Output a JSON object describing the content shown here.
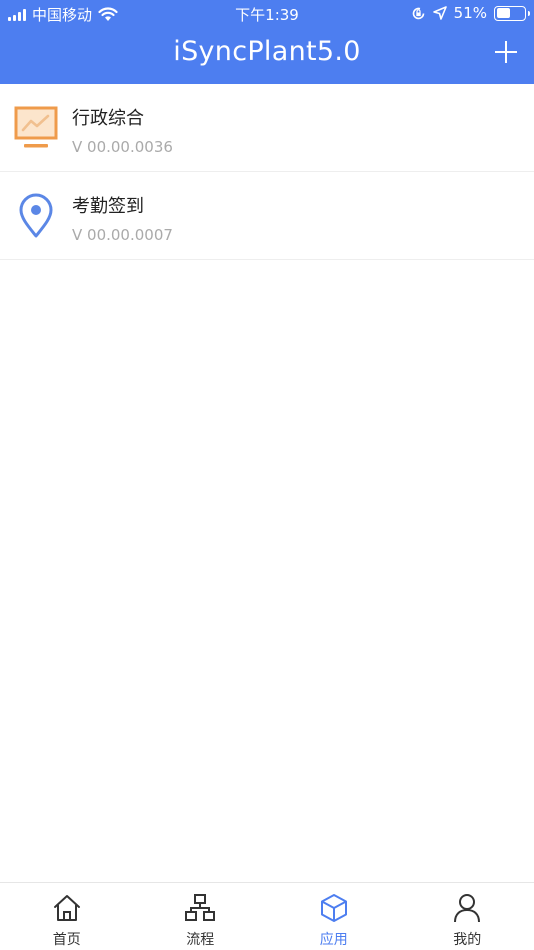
{
  "status_bar": {
    "carrier": "中国移动",
    "time": "下午1:39",
    "battery": "51%",
    "battery_level": 0.51,
    "icons": [
      "signal-icon",
      "wifi-icon",
      "orientation-lock-icon",
      "location-icon",
      "battery-icon"
    ]
  },
  "header": {
    "title": "iSyncPlant5.0",
    "add_icon": "plus-icon"
  },
  "apps": [
    {
      "name": "行政综合",
      "version": "V 00.00.0036",
      "icon": "monitor-chart-icon",
      "color": "#ef9b4b"
    },
    {
      "name": "考勤签到",
      "version": "V 00.00.0007",
      "icon": "location-pin-icon",
      "color": "#5b87e6"
    }
  ],
  "tabs": [
    {
      "label": "首页",
      "icon": "home-icon",
      "active": false
    },
    {
      "label": "流程",
      "icon": "flow-icon",
      "active": false
    },
    {
      "label": "应用",
      "icon": "cube-icon",
      "active": true
    },
    {
      "label": "我的",
      "icon": "user-icon",
      "active": false
    }
  ],
  "colors": {
    "primary": "#4d7ef0",
    "tab_inactive": "#333333",
    "version_text": "#aaaaaa"
  }
}
